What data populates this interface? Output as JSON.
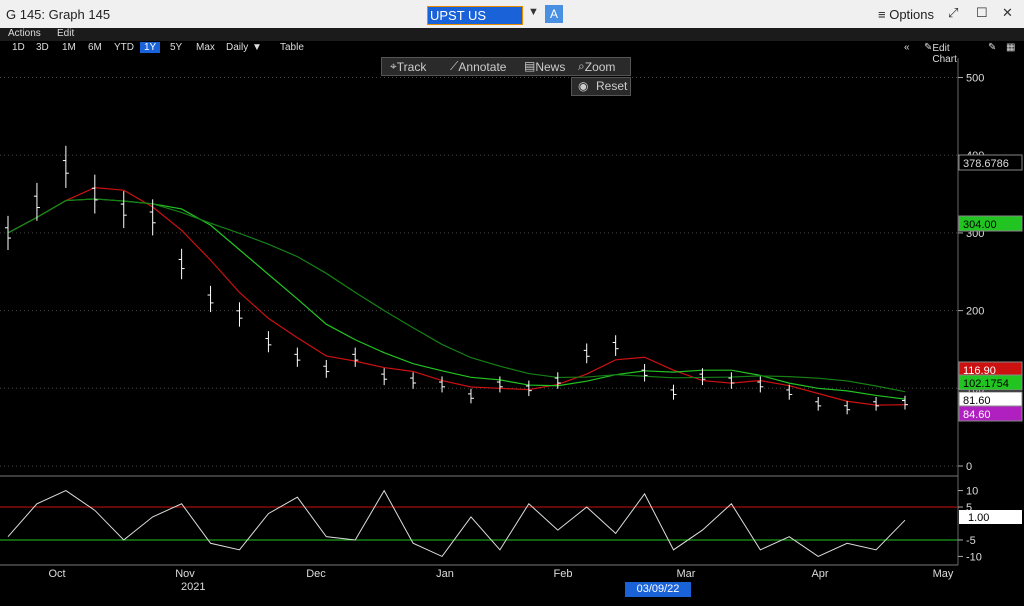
{
  "window": {
    "title": "G 145: Graph 145",
    "ticker": "UPST US Equity",
    "ticker_badge": "A",
    "options_label": "Options"
  },
  "menu": {
    "actions": "Actions",
    "edit": "Edit"
  },
  "ranges": [
    "1D",
    "3D",
    "1M",
    "6M",
    "YTD",
    "1Y",
    "5Y",
    "Max",
    "Daily",
    "Table"
  ],
  "selected_range": "1Y",
  "right_menu": {
    "edit_chart": "Edit Chart"
  },
  "toolbar": {
    "track": "Track",
    "annotate": "Annotate",
    "news": "News",
    "zoom": "Zoom",
    "reset": "Reset"
  },
  "price_axis": {
    "ticks": [
      "500",
      "400",
      "300",
      "200",
      "100",
      "0"
    ]
  },
  "price_labels": {
    "last_high": "378.6786",
    "ma_a": "304.00",
    "ma_b": "116.90",
    "ma_c": "102.1754",
    "last": "81.60",
    "lowlabel": "84.60"
  },
  "osc_axis": {
    "ticks": [
      "10",
      "5",
      "-5",
      "-10"
    ],
    "current": "1.00"
  },
  "months": [
    "Oct",
    "Nov",
    "Dec",
    "Jan",
    "Feb",
    "Mar",
    "Apr",
    "May"
  ],
  "year": "2021",
  "cursor_date": "03/09/22",
  "colors": {
    "green": "#22c422",
    "red": "#cc1111",
    "magenta": "#b020c0",
    "white": "#ffffff"
  },
  "chart_data": {
    "type": "line",
    "x": [
      "2021-09-20",
      "2021-09-27",
      "2021-10-04",
      "2021-10-11",
      "2021-10-18",
      "2021-10-25",
      "2021-11-01",
      "2021-11-08",
      "2021-11-15",
      "2021-11-22",
      "2021-11-29",
      "2021-12-06",
      "2021-12-13",
      "2021-12-20",
      "2021-12-27",
      "2022-01-03",
      "2022-01-10",
      "2022-01-17",
      "2022-01-24",
      "2022-01-31",
      "2022-02-07",
      "2022-02-14",
      "2022-02-21",
      "2022-02-28",
      "2022-03-07",
      "2022-03-14",
      "2022-03-21",
      "2022-03-28",
      "2022-04-04",
      "2022-04-11",
      "2022-04-18",
      "2022-04-25"
    ],
    "series": [
      {
        "name": "",
        "values": [
          300,
          340,
          385,
          350,
          330,
          320,
          260,
          215,
          195,
          160,
          140,
          125,
          140,
          115,
          110,
          105,
          90,
          105,
          100,
          110,
          145,
          155,
          120,
          95,
          115,
          110,
          105,
          95,
          80,
          75,
          80,
          81.6
        ]
      }
    ],
    "ylim": [
      0,
      520
    ],
    "oscillator": {
      "values": [
        -4,
        6,
        10,
        4,
        -5,
        2,
        6,
        -6,
        -8,
        3,
        8,
        -4,
        -5,
        10,
        -6,
        -10,
        2,
        -8,
        6,
        -2,
        5,
        -3,
        9,
        -8,
        -2,
        6,
        -8,
        -4,
        -10,
        -6,
        -8,
        1.0
      ],
      "ylim": [
        -12,
        12
      ]
    }
  }
}
